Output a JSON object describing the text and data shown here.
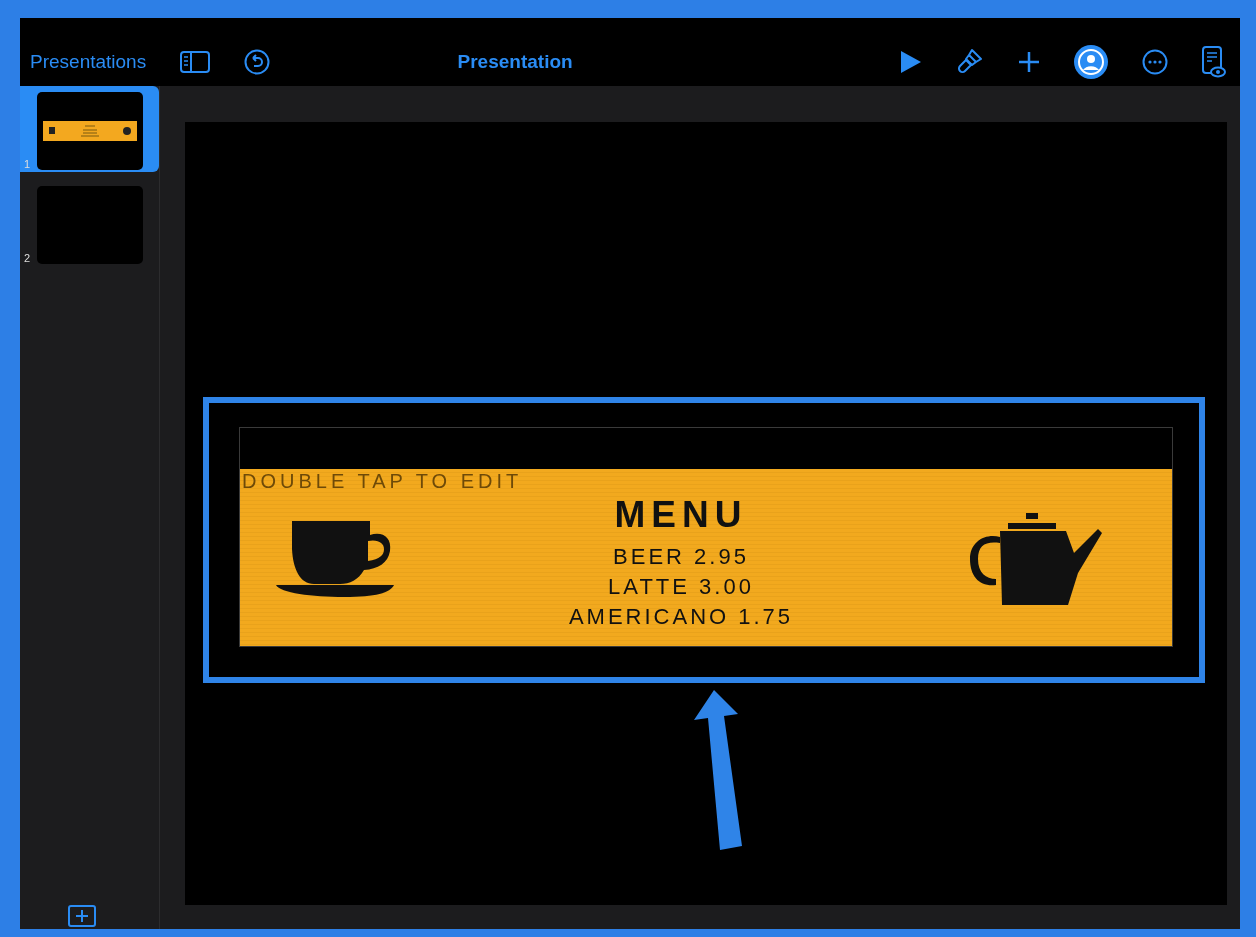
{
  "toolbar": {
    "back_label": "Presentations",
    "title": "Presentation"
  },
  "slides": [
    {
      "number": "1",
      "selected": true,
      "kind": "menu"
    },
    {
      "number": "2",
      "selected": false,
      "kind": "blank"
    }
  ],
  "slide": {
    "selected": true,
    "hint": "DOUBLE TAP TO EDIT",
    "heading": "MENU",
    "items": [
      "BEER 2.95",
      "LATTE 3.00",
      "AMERICANO 1.75"
    ]
  }
}
